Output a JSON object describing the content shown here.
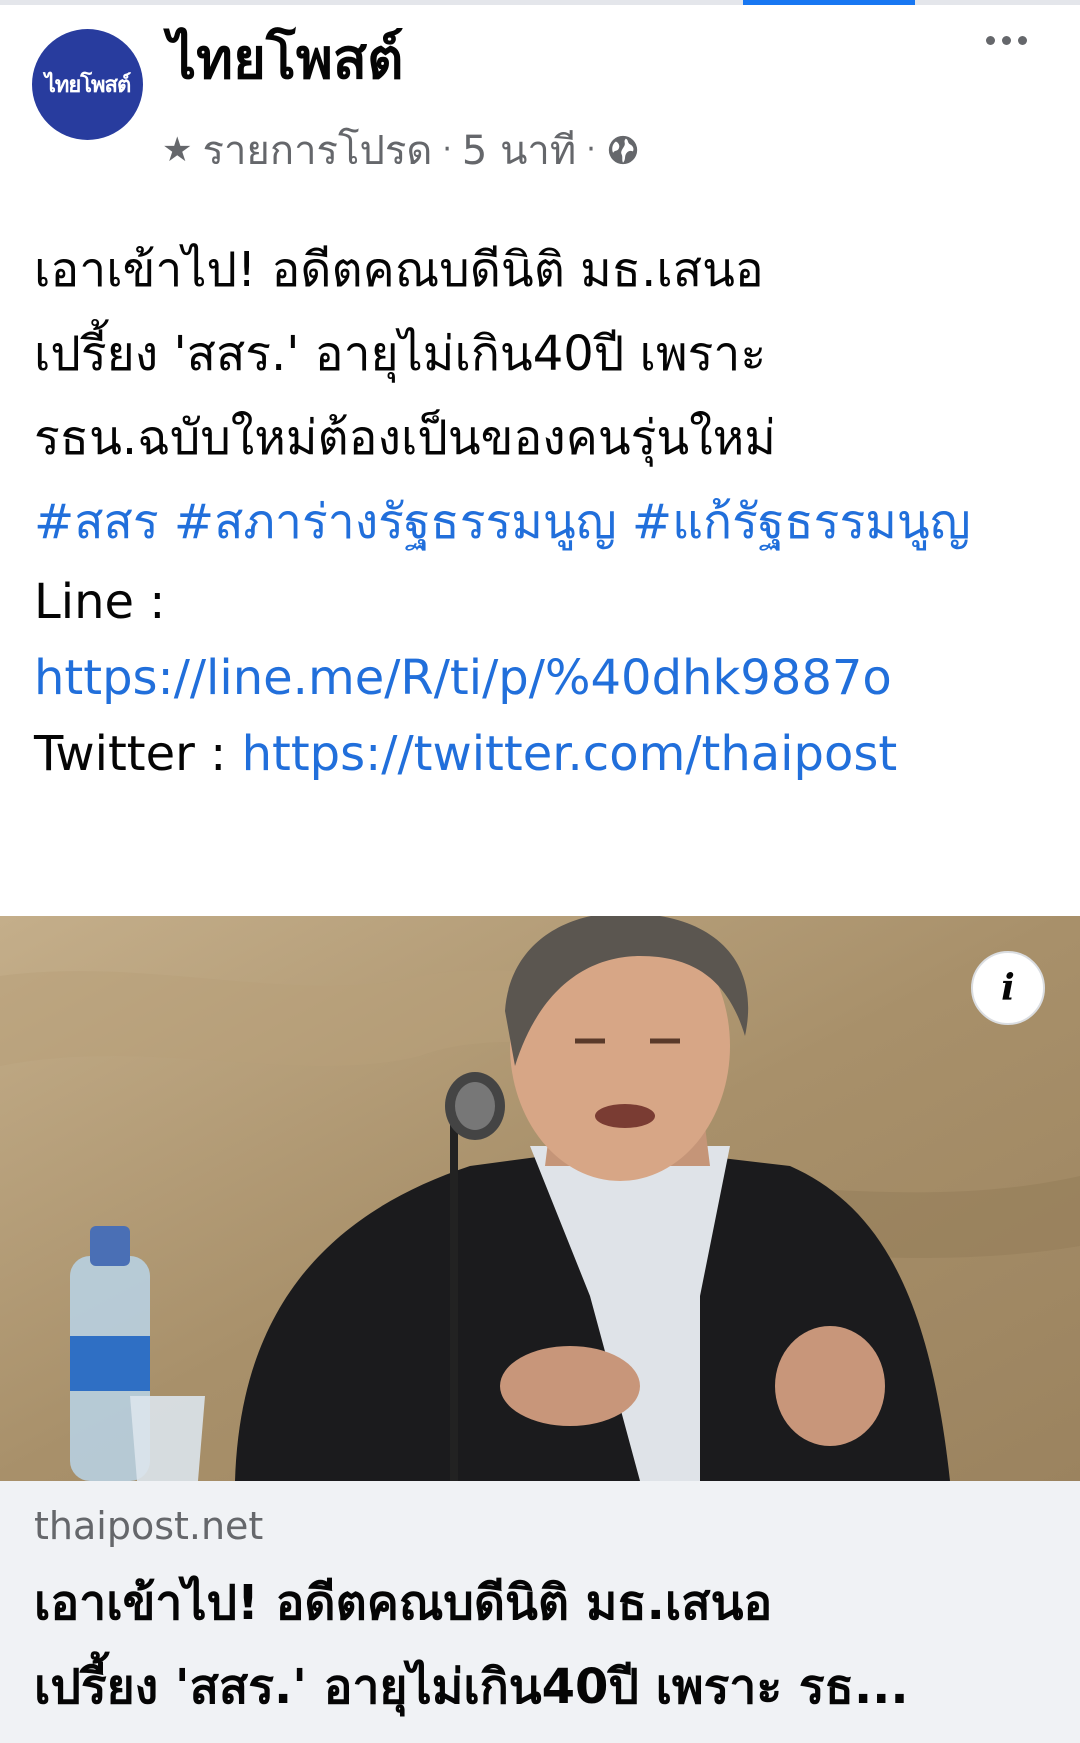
{
  "header": {
    "avatar_text": "ไทยโพสต์",
    "page_name": "ไทยโพสต์",
    "meta": {
      "star_icon": "star-icon",
      "favorites_label": "รายการโปรด",
      "separator": "·",
      "time_ago": "5 นาที",
      "audience_icon": "globe-icon"
    },
    "more_icon": "more-horizontal-icon"
  },
  "post": {
    "text_lines": [
      "เอาเข้าไป! อดีตคณบดีนิติ มธ.เสนอ",
      "เปรี้ยง 'สสร.' อายุไม่เกิน40ปี เพราะ",
      "รธน.ฉบับใหม่ต้องเป็นของคนรุ่นใหม่"
    ],
    "hashtags": [
      "#สสร",
      "#สภาร่างรัฐธรรมนูญ",
      "#แก้รัฐธรรมนูญ"
    ],
    "line_label": "Line :",
    "line_url": "https://line.me/R/ti/p/%40dhk9887o",
    "twitter_label": "Twitter :",
    "twitter_url": "https://twitter.com/thaipost"
  },
  "link_preview": {
    "domain": "thaipost.net",
    "title_lines": [
      "เอาเข้าไป! อดีตคณบดีนิติ มธ.เสนอ",
      "เปรี้ยง 'สสร.' อายุไม่เกิน40ปี เพราะ รธ..."
    ],
    "info_icon": "info-icon",
    "info_glyph": "i"
  },
  "colors": {
    "accent": "#1877f2",
    "link": "#216fdb",
    "meta_text": "#65676b",
    "avatar_bg": "#283c9e",
    "preview_bg": "#f0f2f5"
  }
}
